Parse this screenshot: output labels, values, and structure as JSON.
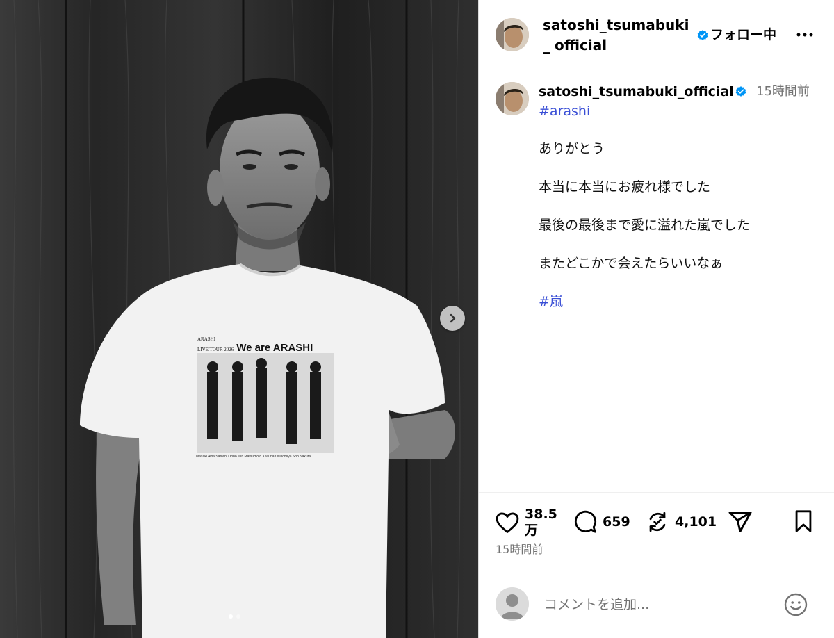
{
  "post": {
    "username": "satoshi_tsumabuki_official",
    "header_username": "satoshi_tsumabuki_ official",
    "follow_label": "フォロー中",
    "verified": true,
    "caption_time": "15時間前",
    "caption_hashtag": "#arashi",
    "caption_lines": [
      "ありがとう",
      "本当に本当にお疲れ様でした",
      "最後の最後まで愛に溢れた嵐でした",
      "またどこかで会えたらいいなぁ"
    ],
    "caption_end_hashtag": "#嵐",
    "likes": "38.5 万",
    "comments": "659",
    "reposts": "4,101",
    "posted_time": "15時間前",
    "comment_placeholder": "コメントを追加...",
    "carousel": {
      "current": 1,
      "total": 2
    }
  },
  "shirt_print": {
    "title_small": "ARASHI",
    "title_tour": "LIVE TOUR 2026",
    "title_big": "We are ARASHI",
    "names": "Masaki Aiba  Satoshi Ohno  Jun Matsumoto  Kazunari Ninomiya  Sho Sakurai"
  },
  "icons": {
    "more": "more-horizontal-icon",
    "next": "chevron-right-icon",
    "like": "heart-icon",
    "comment": "comment-bubble-icon",
    "repost": "repost-icon",
    "share": "share-send-icon",
    "save": "bookmark-icon",
    "emoji": "smile-emoji-icon",
    "verified": "verified-badge-icon"
  },
  "colors": {
    "link": "#3a4fd6",
    "verified": "#0095f6",
    "muted": "#737373"
  }
}
